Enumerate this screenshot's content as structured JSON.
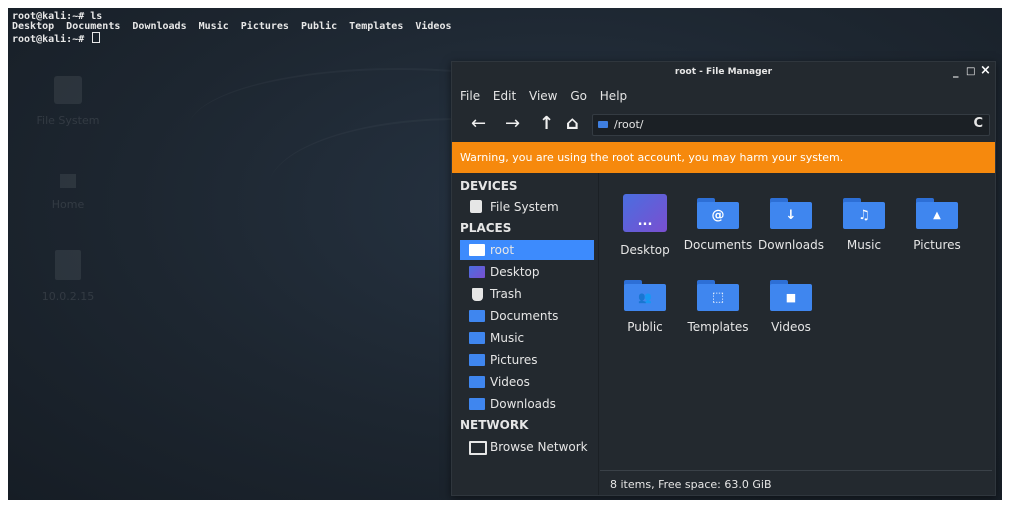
{
  "terminal": {
    "line1": "root@kali:~# ls",
    "line2": "Desktop  Documents  Downloads  Music  Pictures  Public  Templates  Videos",
    "line3": "root@kali:~# "
  },
  "desktop_icons": [
    {
      "label": "File System",
      "icon": "drive-icon"
    },
    {
      "label": "Home",
      "icon": "home-icon"
    },
    {
      "label": "10.0.2.15",
      "icon": "file-icon"
    }
  ],
  "window": {
    "title": "root - File Manager",
    "controls": {
      "minimize": "_",
      "maximize": "□",
      "close": "×"
    }
  },
  "menu": [
    "File",
    "Edit",
    "View",
    "Go",
    "Help"
  ],
  "toolbar": {
    "back": "←",
    "forward": "→",
    "up": "↑",
    "home": "⌂",
    "location": "/root/",
    "refresh": "C"
  },
  "warning": "Warning, you are using the root account, you may harm your system.",
  "sidebar": {
    "devices_header": "DEVICES",
    "places_header": "PLACES",
    "network_header": "NETWORK",
    "devices": [
      {
        "label": "File System",
        "icon": "drive-icon"
      }
    ],
    "places": [
      {
        "label": "root",
        "icon": "home-folder-icon",
        "selected": true
      },
      {
        "label": "Desktop",
        "icon": "desktop-icon"
      },
      {
        "label": "Trash",
        "icon": "trash-icon"
      },
      {
        "label": "Documents",
        "icon": "documents-folder-icon"
      },
      {
        "label": "Music",
        "icon": "music-folder-icon"
      },
      {
        "label": "Pictures",
        "icon": "pictures-folder-icon"
      },
      {
        "label": "Videos",
        "icon": "videos-folder-icon"
      },
      {
        "label": "Downloads",
        "icon": "downloads-folder-icon"
      }
    ],
    "network": [
      {
        "label": "Browse Network",
        "icon": "network-icon"
      }
    ]
  },
  "files": [
    {
      "label": "Desktop",
      "icon": "desktop-folder-icon",
      "glyph": "..."
    },
    {
      "label": "Documents",
      "icon": "documents-folder-icon",
      "glyph": "@"
    },
    {
      "label": "Downloads",
      "icon": "downloads-folder-icon",
      "glyph": "↓"
    },
    {
      "label": "Music",
      "icon": "music-folder-icon",
      "glyph": "♫"
    },
    {
      "label": "Pictures",
      "icon": "pictures-folder-icon",
      "glyph": "▲"
    },
    {
      "label": "Public",
      "icon": "public-folder-icon",
      "glyph": "👥"
    },
    {
      "label": "Templates",
      "icon": "templates-folder-icon",
      "glyph": "⬚"
    },
    {
      "label": "Videos",
      "icon": "videos-folder-icon",
      "glyph": "■"
    }
  ],
  "status": "8 items, Free space: 63.0 GiB",
  "colors": {
    "accent": "#3d8bfd",
    "warning": "#f6890d",
    "folder": "#3f86ef",
    "window_bg": "#23292f",
    "desktop_bg": "#1d2630"
  }
}
